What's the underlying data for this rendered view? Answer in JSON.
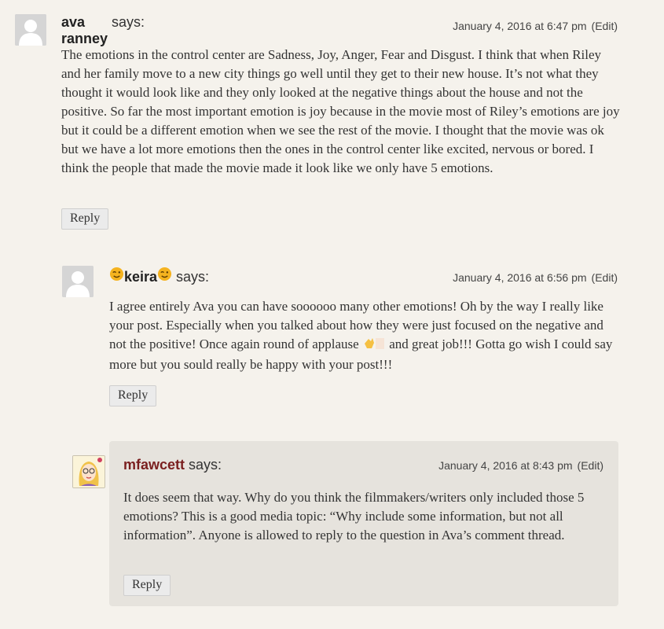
{
  "comments": [
    {
      "author": "ava ranney",
      "says": "says:",
      "date": "January 4, 2016 at 6:47 pm",
      "edit": "(Edit)",
      "text": "The emotions in the control center are Sadness, Joy, Anger, Fear and Disgust. I think that when Riley and her family move to a new city things go well until they get to their new house. It’s not what they thought it would look like and they only looked at the negative things about the house and not the positive. So far the most important emotion is joy because in the movie most of Riley’s emotions are joy but it could be a different emotion when we see the rest of the movie. I thought that the movie was ok but we have a lot more emotions then the ones in the control center like excited, nervous or bored. I think the people that made the movie made it look like we only have 5 emotions.",
      "reply": "Reply"
    },
    {
      "author": "keira",
      "author_emoji": "😉",
      "says": "says:",
      "date": "January 4, 2016 at 6:56 pm",
      "edit": "(Edit)",
      "text_before_emoji": "I agree entirely Ava you can have soooooo many other emotions! Oh by the way I really like your post. Especially when you talked about how they were just focused on the negative and not the positive! Once again round of applause",
      "text_after_emoji": "and great job!!! Gotta go wish I could say more but you sould really be happy with your post!!!",
      "reply": "Reply"
    },
    {
      "author": "mfawcett",
      "says": "says:",
      "date": "January 4, 2016 at 8:43 pm",
      "edit": "(Edit)",
      "text": "It does seem that way. Why do you think the filmmakers/writers only included those 5 emotions? This is a good media topic: “Why include some information, but not all information”. Anyone is allowed to reply to the question in Ava’s comment thread.",
      "reply": "Reply"
    }
  ],
  "icons": {
    "default_avatar": "person-silhouette-icon",
    "admin_avatar": "cartoon-avatar-icon",
    "wink_emoji": "winking-face-icon",
    "clap_emoji": "clapping-hands-icon"
  },
  "colors": {
    "background": "#f5f2ec",
    "admin_highlight": "#e6e3dd",
    "admin_name": "#7a1f1f"
  }
}
